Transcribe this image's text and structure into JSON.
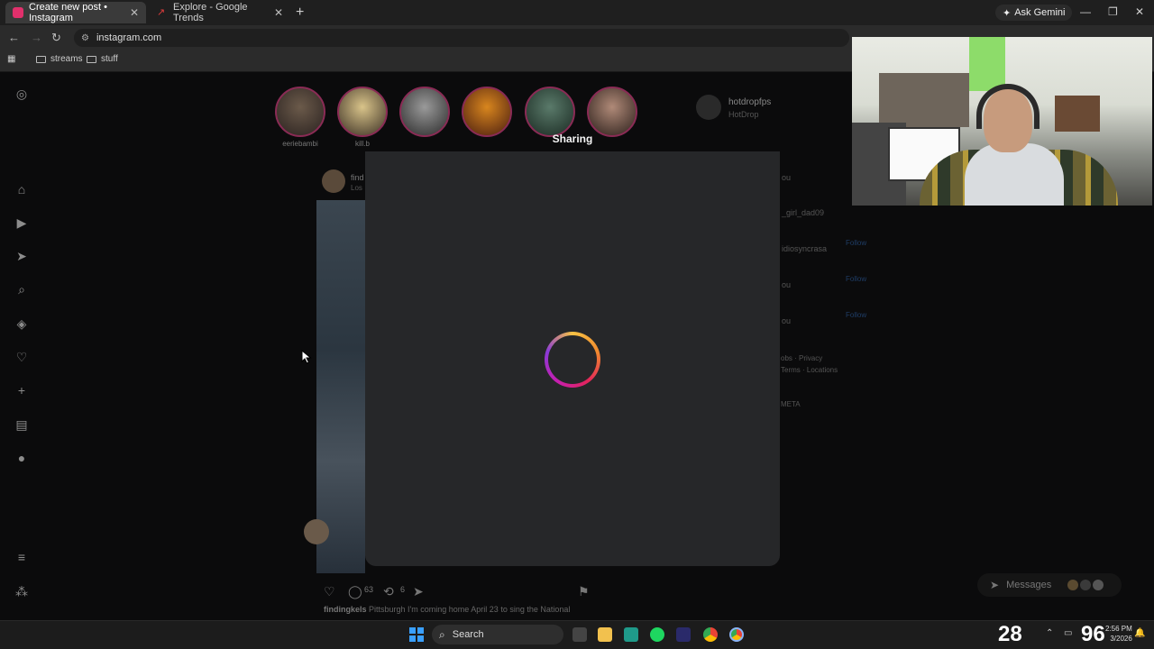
{
  "browser": {
    "tabs": [
      {
        "title": "Create new post • Instagram",
        "active": true,
        "favicon_color": "#e1306c"
      },
      {
        "title": "Explore - Google Trends",
        "active": false,
        "favicon_color": "#e23c3c"
      }
    ],
    "new_tab": "+",
    "gemini_label": "Ask Gemini",
    "url": "instagram.com",
    "bookmarks": [
      "streams",
      "stuff"
    ]
  },
  "stories": [
    {
      "label": "eeriebambi"
    },
    {
      "label": "kill.b"
    },
    {
      "label": ""
    },
    {
      "label": ""
    },
    {
      "label": ""
    },
    {
      "label": ""
    }
  ],
  "sidebar_profile": {
    "username": "hotdropfps",
    "name": "HotDrop"
  },
  "post": {
    "user": "find",
    "location": "Los",
    "likes_icon": "heart-icon",
    "comments": "63",
    "reposts": "6",
    "caption_user": "findingkels",
    "caption_text": "Pittsburgh I'm coming home April 23 to sing the National"
  },
  "suggestions": {
    "you_label": "ou",
    "users": [
      "_girl_dad09",
      "idiosyncrasa",
      "ou",
      "ou"
    ],
    "follow_label": "Follow",
    "footer1": "obs · Privacy",
    "footer2": "Terms · Locations",
    "meta": "META"
  },
  "modal": {
    "title": "Sharing"
  },
  "messages": {
    "label": "Messages"
  },
  "taskbar": {
    "search": "Search",
    "temperature": "28",
    "tray_number": "96",
    "time": "2:56 PM",
    "date": "3/2026"
  }
}
